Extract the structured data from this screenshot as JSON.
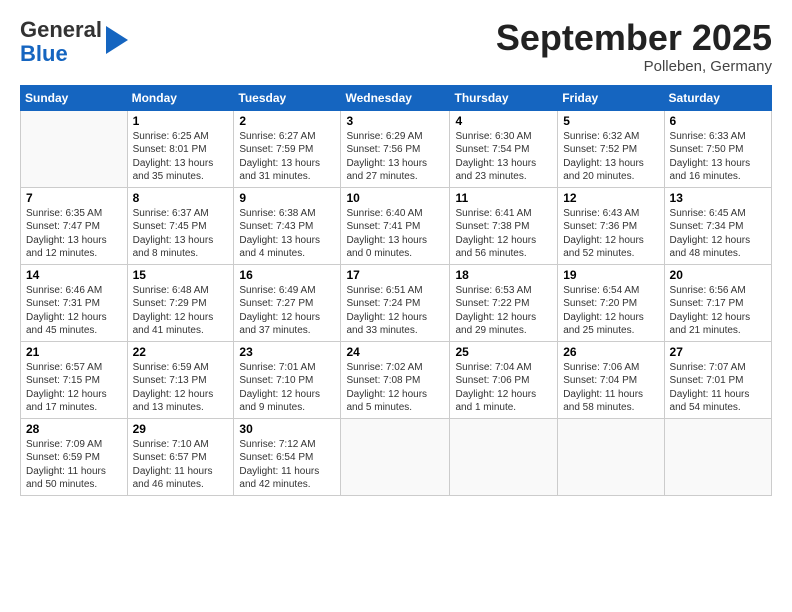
{
  "logo": {
    "general": "General",
    "blue": "Blue"
  },
  "header": {
    "month": "September 2025",
    "location": "Polleben, Germany"
  },
  "weekdays": [
    "Sunday",
    "Monday",
    "Tuesday",
    "Wednesday",
    "Thursday",
    "Friday",
    "Saturday"
  ],
  "weeks": [
    [
      {
        "day": "",
        "info": ""
      },
      {
        "day": "1",
        "info": "Sunrise: 6:25 AM\nSunset: 8:01 PM\nDaylight: 13 hours\nand 35 minutes."
      },
      {
        "day": "2",
        "info": "Sunrise: 6:27 AM\nSunset: 7:59 PM\nDaylight: 13 hours\nand 31 minutes."
      },
      {
        "day": "3",
        "info": "Sunrise: 6:29 AM\nSunset: 7:56 PM\nDaylight: 13 hours\nand 27 minutes."
      },
      {
        "day": "4",
        "info": "Sunrise: 6:30 AM\nSunset: 7:54 PM\nDaylight: 13 hours\nand 23 minutes."
      },
      {
        "day": "5",
        "info": "Sunrise: 6:32 AM\nSunset: 7:52 PM\nDaylight: 13 hours\nand 20 minutes."
      },
      {
        "day": "6",
        "info": "Sunrise: 6:33 AM\nSunset: 7:50 PM\nDaylight: 13 hours\nand 16 minutes."
      }
    ],
    [
      {
        "day": "7",
        "info": "Sunrise: 6:35 AM\nSunset: 7:47 PM\nDaylight: 13 hours\nand 12 minutes."
      },
      {
        "day": "8",
        "info": "Sunrise: 6:37 AM\nSunset: 7:45 PM\nDaylight: 13 hours\nand 8 minutes."
      },
      {
        "day": "9",
        "info": "Sunrise: 6:38 AM\nSunset: 7:43 PM\nDaylight: 13 hours\nand 4 minutes."
      },
      {
        "day": "10",
        "info": "Sunrise: 6:40 AM\nSunset: 7:41 PM\nDaylight: 13 hours\nand 0 minutes."
      },
      {
        "day": "11",
        "info": "Sunrise: 6:41 AM\nSunset: 7:38 PM\nDaylight: 12 hours\nand 56 minutes."
      },
      {
        "day": "12",
        "info": "Sunrise: 6:43 AM\nSunset: 7:36 PM\nDaylight: 12 hours\nand 52 minutes."
      },
      {
        "day": "13",
        "info": "Sunrise: 6:45 AM\nSunset: 7:34 PM\nDaylight: 12 hours\nand 48 minutes."
      }
    ],
    [
      {
        "day": "14",
        "info": "Sunrise: 6:46 AM\nSunset: 7:31 PM\nDaylight: 12 hours\nand 45 minutes."
      },
      {
        "day": "15",
        "info": "Sunrise: 6:48 AM\nSunset: 7:29 PM\nDaylight: 12 hours\nand 41 minutes."
      },
      {
        "day": "16",
        "info": "Sunrise: 6:49 AM\nSunset: 7:27 PM\nDaylight: 12 hours\nand 37 minutes."
      },
      {
        "day": "17",
        "info": "Sunrise: 6:51 AM\nSunset: 7:24 PM\nDaylight: 12 hours\nand 33 minutes."
      },
      {
        "day": "18",
        "info": "Sunrise: 6:53 AM\nSunset: 7:22 PM\nDaylight: 12 hours\nand 29 minutes."
      },
      {
        "day": "19",
        "info": "Sunrise: 6:54 AM\nSunset: 7:20 PM\nDaylight: 12 hours\nand 25 minutes."
      },
      {
        "day": "20",
        "info": "Sunrise: 6:56 AM\nSunset: 7:17 PM\nDaylight: 12 hours\nand 21 minutes."
      }
    ],
    [
      {
        "day": "21",
        "info": "Sunrise: 6:57 AM\nSunset: 7:15 PM\nDaylight: 12 hours\nand 17 minutes."
      },
      {
        "day": "22",
        "info": "Sunrise: 6:59 AM\nSunset: 7:13 PM\nDaylight: 12 hours\nand 13 minutes."
      },
      {
        "day": "23",
        "info": "Sunrise: 7:01 AM\nSunset: 7:10 PM\nDaylight: 12 hours\nand 9 minutes."
      },
      {
        "day": "24",
        "info": "Sunrise: 7:02 AM\nSunset: 7:08 PM\nDaylight: 12 hours\nand 5 minutes."
      },
      {
        "day": "25",
        "info": "Sunrise: 7:04 AM\nSunset: 7:06 PM\nDaylight: 12 hours\nand 1 minute."
      },
      {
        "day": "26",
        "info": "Sunrise: 7:06 AM\nSunset: 7:04 PM\nDaylight: 11 hours\nand 58 minutes."
      },
      {
        "day": "27",
        "info": "Sunrise: 7:07 AM\nSunset: 7:01 PM\nDaylight: 11 hours\nand 54 minutes."
      }
    ],
    [
      {
        "day": "28",
        "info": "Sunrise: 7:09 AM\nSunset: 6:59 PM\nDaylight: 11 hours\nand 50 minutes."
      },
      {
        "day": "29",
        "info": "Sunrise: 7:10 AM\nSunset: 6:57 PM\nDaylight: 11 hours\nand 46 minutes."
      },
      {
        "day": "30",
        "info": "Sunrise: 7:12 AM\nSunset: 6:54 PM\nDaylight: 11 hours\nand 42 minutes."
      },
      {
        "day": "",
        "info": ""
      },
      {
        "day": "",
        "info": ""
      },
      {
        "day": "",
        "info": ""
      },
      {
        "day": "",
        "info": ""
      }
    ]
  ]
}
